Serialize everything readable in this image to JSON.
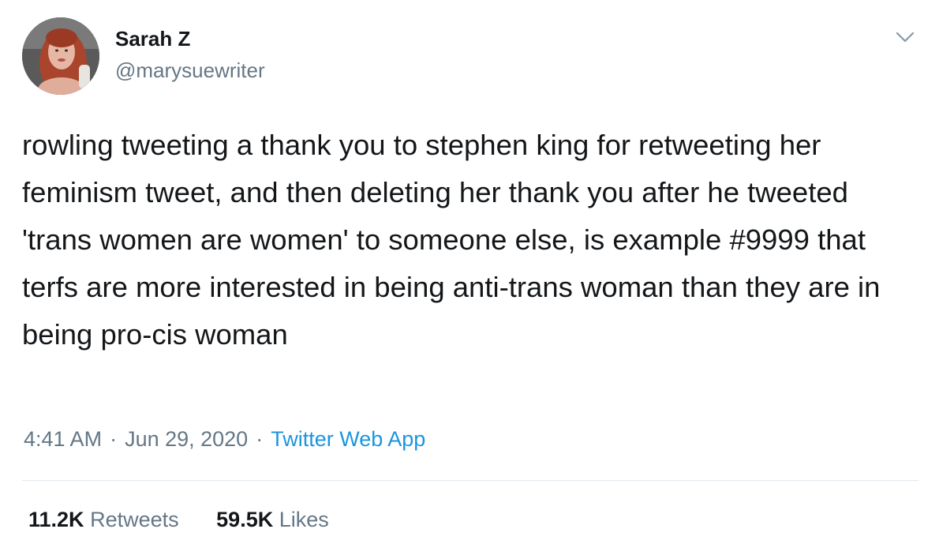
{
  "author": {
    "name": "Sarah Z",
    "handle": "@marysuewriter"
  },
  "tweet": {
    "text": "rowling tweeting a thank you to stephen king for retweeting her feminism tweet, and then deleting her thank you after he tweeted 'trans women are women' to someone else, is example #9999 that terfs are more interested in being anti-trans woman than they are in being pro-cis woman",
    "time": "4:41 AM",
    "date": "Jun 29, 2020",
    "separator": "·",
    "source": "Twitter Web App"
  },
  "stats": {
    "retweets_count": "11.2K",
    "retweets_label": "Retweets",
    "likes_count": "59.5K",
    "likes_label": "Likes"
  },
  "icons": {
    "menu": "chevron-down-icon",
    "avatar": "avatar"
  },
  "colors": {
    "text": "#14171a",
    "secondary": "#657786",
    "link": "#1b95e0",
    "divider": "#e1e8ed"
  }
}
